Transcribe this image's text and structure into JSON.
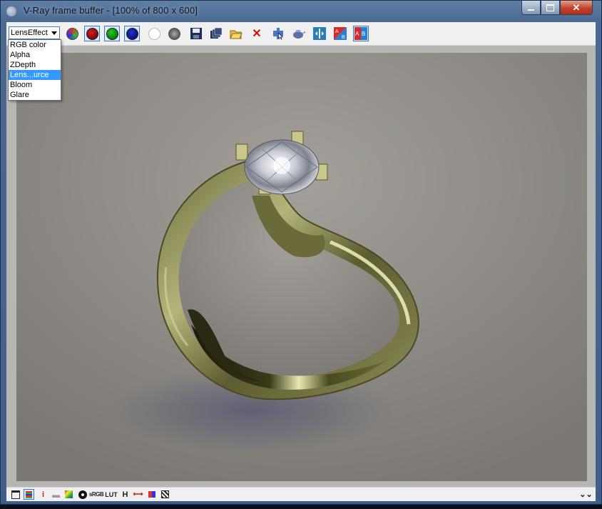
{
  "window": {
    "title": "V-Ray frame buffer - [100% of 800 x 600]",
    "controls": [
      "minimize-icon",
      "maximize-icon",
      "close-icon"
    ]
  },
  "toolbar": {
    "channel_select_value": "LensEffect",
    "channel_options": [
      "RGB color",
      "Alpha",
      "ZDepth",
      "Lens...urce",
      "Bloom",
      "Glare"
    ],
    "highlighted_option": "Lens...urce",
    "buttons": [
      {
        "icon": "rgb-channel-icon",
        "color": "#33aa33"
      },
      {
        "icon": "red-channel-icon",
        "color": "#8b0000"
      },
      {
        "icon": "green-channel-icon",
        "color": "#008800"
      },
      {
        "icon": "blue-channel-icon",
        "color": "#000088"
      },
      {
        "icon": "alpha-channel-icon",
        "color": "#ffffff"
      },
      {
        "icon": "mono-channel-icon",
        "color": "#555555"
      },
      {
        "icon": "save-icon"
      },
      {
        "icon": "save-all-icon"
      },
      {
        "icon": "load-icon"
      },
      {
        "icon": "clear-icon",
        "color": "#cc1111"
      },
      {
        "icon": "track-mouse-icon"
      },
      {
        "icon": "render-last-icon"
      },
      {
        "icon": "show-corrections-icon"
      },
      {
        "icon": "compare-ab-icon"
      },
      {
        "icon": "history-ab-icon"
      }
    ]
  },
  "statusbar": {
    "icons": [
      "display-icon",
      "corrections-icon",
      "info-icon",
      "levels-icon",
      "curve-icon",
      "exposure-icon",
      "srgb-icon",
      "lut-icon",
      "histogram-h-icon",
      "ocio-icon",
      "stamp-icon",
      "pixel-aspect-icon"
    ],
    "labels": {
      "info": "i",
      "srgb": "sRGB",
      "lut": "LUT",
      "h": "H"
    },
    "expand_icon": "double-chevron-down-icon"
  },
  "colors": {
    "titlebar": "#4a6a92",
    "selection": "#3399ff",
    "ring_gold": "#8a8a5a",
    "background": "#8a8782"
  }
}
